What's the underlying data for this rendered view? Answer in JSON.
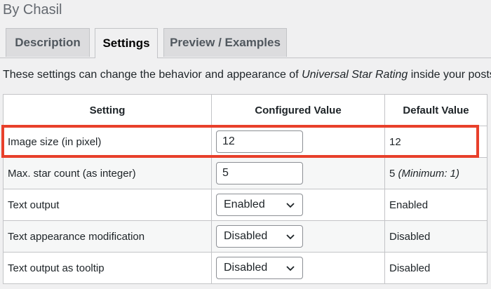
{
  "byline": "By Chasil",
  "tabs": [
    {
      "label": "Description"
    },
    {
      "label": "Settings"
    },
    {
      "label": "Preview / Examples"
    }
  ],
  "intro": {
    "before": "These settings can change the behavior and appearance of ",
    "emphasis": "Universal Star Rating",
    "after": " inside your posts."
  },
  "table": {
    "headers": [
      "Setting",
      "Configured Value",
      "Default Value"
    ],
    "rows": [
      {
        "setting": "Image size (in pixel)",
        "value": "12",
        "default": "12"
      },
      {
        "setting": "Max. star count (as integer)",
        "value": "5",
        "default": "5",
        "default_note": "(Minimum: 1)"
      },
      {
        "setting": "Text output",
        "value": "Enabled",
        "default": "Enabled"
      },
      {
        "setting": "Text appearance modification",
        "value": "Disabled",
        "default": "Disabled"
      },
      {
        "setting": "Text output as tooltip",
        "value": "Disabled",
        "default": "Disabled"
      }
    ]
  },
  "colors": {
    "highlight": "#e8402b",
    "page_background": "#f0f0f1"
  }
}
